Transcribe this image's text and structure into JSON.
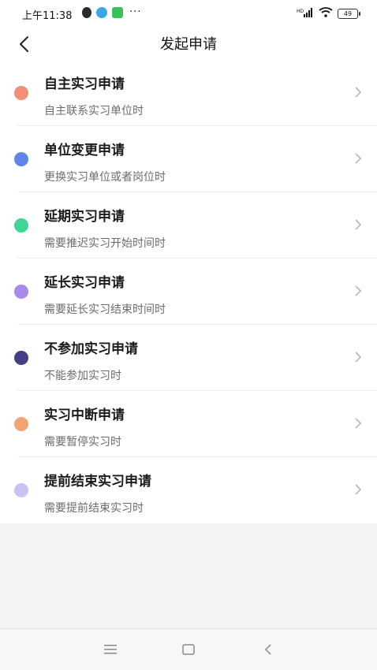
{
  "status_bar": {
    "time": "上午11:38",
    "network": "HD",
    "battery": "49"
  },
  "nav": {
    "title": "发起申请"
  },
  "items": [
    {
      "title": "自主实习申请",
      "subtitle": "自主联系实习单位时",
      "color": "#f28d78"
    },
    {
      "title": "单位变更申请",
      "subtitle": "更换实习单位或者岗位时",
      "color": "#5e86ea"
    },
    {
      "title": "延期实习申请",
      "subtitle": "需要推迟实习开始时间时",
      "color": "#3fd693"
    },
    {
      "title": "延长实习申请",
      "subtitle": "需要延长实习结束时间时",
      "color": "#a98aec"
    },
    {
      "title": "不参加实习申请",
      "subtitle": "不能参加实习时",
      "color": "#443f82"
    },
    {
      "title": "实习中断申请",
      "subtitle": "需要暂停实习时",
      "color": "#f4a474"
    },
    {
      "title": "提前结束实习申请",
      "subtitle": "需要提前结束实习时",
      "color": "#c9c3f4"
    }
  ],
  "system_nav": {
    "menu": "menu-icon",
    "home": "home-icon",
    "back": "back-icon"
  }
}
